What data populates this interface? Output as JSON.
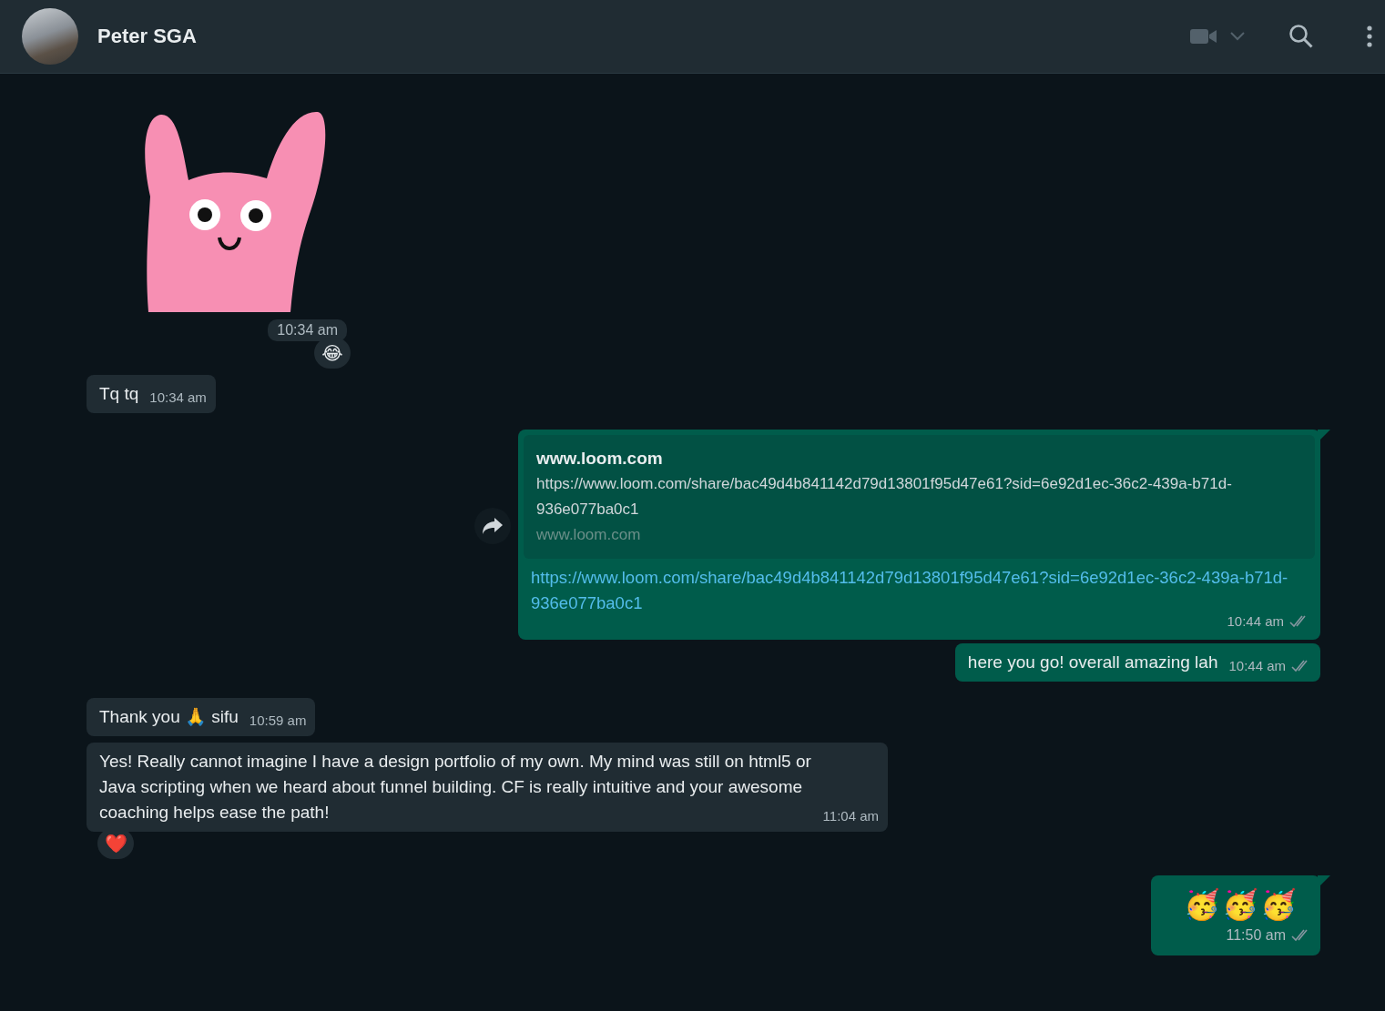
{
  "header": {
    "contact_name": "Peter SGA"
  },
  "messages": [
    {
      "kind": "sticker",
      "outgoing": false,
      "time": "10:34 am",
      "reaction": "😂"
    },
    {
      "kind": "text",
      "outgoing": false,
      "text": "Tq tq",
      "time": "10:34 am"
    },
    {
      "kind": "link",
      "outgoing": true,
      "preview_title": "www.loom.com",
      "preview_description": "https://www.loom.com/share/bac49d4b841142d79d13801f95d47e61?sid=6e92d1ec-36c2-439a-b71d-936e077ba0c1",
      "preview_domain": "www.loom.com",
      "text": "https://www.loom.com/share/bac49d4b841142d79d13801f95d47e61?sid=6e92d1ec-36c2-439a-b71d-936e077ba0c1",
      "time": "10:44 am",
      "read": false,
      "forward": true
    },
    {
      "kind": "text",
      "outgoing": true,
      "text": "here you go! overall amazing lah",
      "time": "10:44 am",
      "read": false
    },
    {
      "kind": "text",
      "outgoing": false,
      "text": "Thank you 🙏 sifu",
      "time": "10:59 am"
    },
    {
      "kind": "text",
      "outgoing": false,
      "text": "Yes! Really cannot imagine I have a design portfolio of my own. My mind was still on html5 or Java scripting when we heard about funnel building. CF is really intuitive and your awesome coaching helps ease the path!",
      "time": "11:04 am",
      "reaction": "❤️"
    },
    {
      "kind": "emoji",
      "outgoing": true,
      "text": "🥳🥳🥳",
      "time": "11:50 am",
      "read": false
    }
  ]
}
